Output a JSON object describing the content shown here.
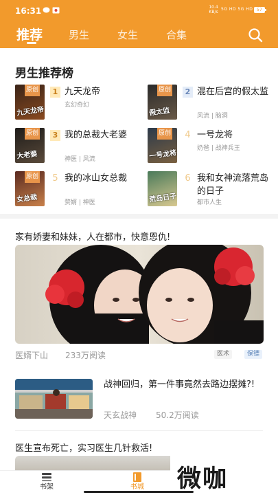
{
  "status_bar": {
    "time": "16:31",
    "network_speed": "10.4\nKB/s",
    "signal": "5G HD 5G HD",
    "battery": "57"
  },
  "tabs": [
    {
      "label": "推荐",
      "active": true
    },
    {
      "label": "男生",
      "active": false
    },
    {
      "label": "女生",
      "active": false
    },
    {
      "label": "合集",
      "active": false
    }
  ],
  "ranking": {
    "title": "男生推荐榜",
    "badge_label": "原创",
    "books": [
      {
        "rank": "1",
        "name": "九天龙帝",
        "tags": "玄幻奇幻",
        "cover_text": "九天龙帝",
        "cover_colors": [
          "#3a2418",
          "#8a4a20"
        ]
      },
      {
        "rank": "2",
        "name": "混在后宫的假太监",
        "tags": "风流 | 脑洞",
        "cover_text": "假太监",
        "cover_colors": [
          "#2a2a2a",
          "#6a5a48"
        ]
      },
      {
        "rank": "3",
        "name": "我的总裁大老婆",
        "tags": "神医 | 风流",
        "cover_text": "大老婆",
        "cover_colors": [
          "#1e1c1a",
          "#5a4a3a"
        ]
      },
      {
        "rank": "4",
        "name": "一号龙将",
        "tags": "奶爸 | 战神兵王",
        "cover_text": "一号龙将",
        "cover_colors": [
          "#2c3a4a",
          "#7a6040"
        ]
      },
      {
        "rank": "5",
        "name": "我的冰山女总裁",
        "tags": "赘婿 | 神医",
        "cover_text": "女总裁",
        "cover_colors": [
          "#5a2a20",
          "#c8804a"
        ]
      },
      {
        "rank": "6",
        "name": "我和女神流落荒岛的日子",
        "tags": "都市人生",
        "cover_text": "荒岛日子",
        "cover_colors": [
          "#4a7a5a",
          "#d8c890"
        ]
      }
    ]
  },
  "feed": [
    {
      "headline": "家有娇妻和妹妹，人在都市，快意恩仇!",
      "author": "医婿下山",
      "reads": "233万阅读",
      "chips": [
        "医术",
        "保镖"
      ]
    },
    {
      "headline": "战神回归，第一件事竟然去路边摆摊?!",
      "author": "天玄战神",
      "reads": "50.2万阅读"
    },
    {
      "headline": "医生宣布死亡，实习医生几针救活!"
    }
  ],
  "bottom_nav": [
    {
      "label": "书架",
      "icon": "bookshelf-icon"
    },
    {
      "label": "书城",
      "icon": "bookstore-icon",
      "active": true
    }
  ],
  "watermark": "微咖",
  "colors": {
    "accent": "#f29a2c"
  }
}
